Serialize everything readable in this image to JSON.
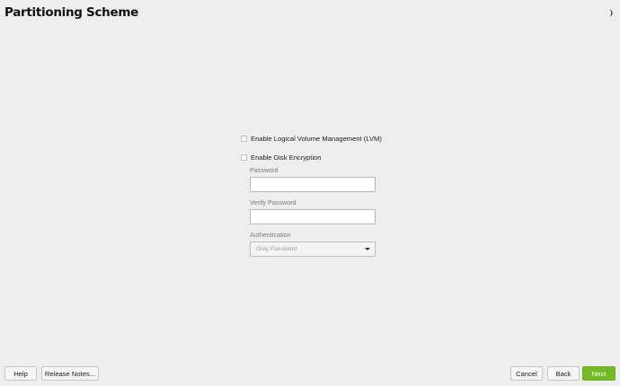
{
  "header": {
    "title": "Partitioning Scheme",
    "theme_icon": "half-moon-icon"
  },
  "options": {
    "lvm_label": "Enable Logical Volume Management (LVM)",
    "lvm_checked": false,
    "encryption_label": "Enable Disk Encryption",
    "encryption_checked": false
  },
  "encryption": {
    "password_label": "Password",
    "password_value": "",
    "verify_label": "Verify Password",
    "verify_value": "",
    "auth_label": "Authentication",
    "auth_selected": "Only Password"
  },
  "footer": {
    "help_label": "Help",
    "release_notes_label": "Release Notes...",
    "cancel_label": "Cancel",
    "back_label": "Back",
    "next_label": "Next"
  },
  "colors": {
    "background": "#eeeeee",
    "accent": "#73ba25"
  }
}
